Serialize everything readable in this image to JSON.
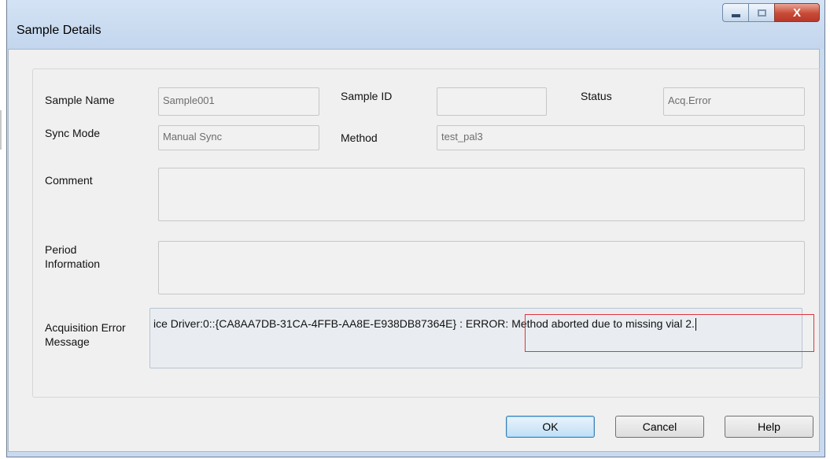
{
  "window": {
    "title": "Sample Details",
    "controls": {
      "minimize_icon": "minimize-icon",
      "maximize_icon": "maximize-icon",
      "close_glyph": "X"
    }
  },
  "fields": {
    "sample_name": {
      "label": "Sample Name",
      "value": "Sample001"
    },
    "sample_id": {
      "label": "Sample ID",
      "value": ""
    },
    "status": {
      "label": "Status",
      "value": "Acq.Error"
    },
    "sync_mode": {
      "label": "Sync Mode",
      "value": "Manual Sync"
    },
    "method": {
      "label": "Method",
      "value": "test_pal3"
    },
    "comment": {
      "label": "Comment",
      "value": ""
    },
    "period_information": {
      "label_line1": "Period",
      "label_line2": "Information",
      "value": ""
    },
    "acquisition_error": {
      "label_line1": "Acquisition Error",
      "label_line2": "Message",
      "value_prefix": "ice Driver:0::{CA8AA7DB-31CA-4FFB-AA8E-E938DB87364E} : ",
      "value_error": "ERROR: Method aborted due to missing vial 2."
    }
  },
  "highlight": {
    "color": "#e0343d"
  },
  "buttons": {
    "ok": "OK",
    "cancel": "Cancel",
    "help": "Help"
  }
}
